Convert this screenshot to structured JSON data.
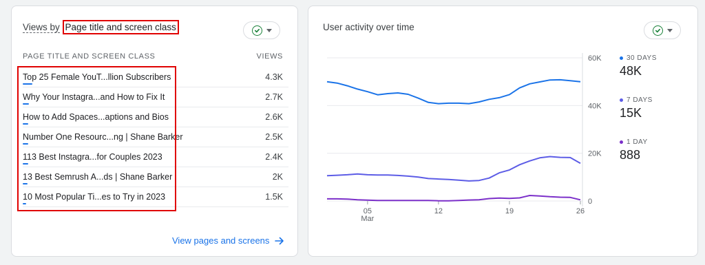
{
  "left_card": {
    "title_prefix": "Views by",
    "title_dimension": "Page title and screen class",
    "col_page": "PAGE TITLE AND SCREEN CLASS",
    "col_views": "VIEWS",
    "rows": [
      {
        "title": "Top 25 Female YouT...llion Subscribers",
        "views": "4.3K",
        "views_num": 4300
      },
      {
        "title": "Why Your Instagra...and How to Fix It",
        "views": "2.7K",
        "views_num": 2700
      },
      {
        "title": "How to Add Spaces...aptions and Bios",
        "views": "2.6K",
        "views_num": 2600
      },
      {
        "title": "Number One Resourc...ng | Shane Barker",
        "views": "2.5K",
        "views_num": 2500
      },
      {
        "title": "113 Best Instagra...for Couples 2023",
        "views": "2.4K",
        "views_num": 2400
      },
      {
        "title": "13 Best Semrush A...ds | Shane Barker",
        "views": "2K",
        "views_num": 2000
      },
      {
        "title": "10 Most Popular Ti...es to Try in 2023",
        "views": "1.5K",
        "views_num": 1500
      }
    ],
    "link": "View pages and screens"
  },
  "right_card": {
    "title": "User activity over time",
    "legend": [
      {
        "label": "30 DAYS",
        "value": "48K",
        "color": "#1a73e8"
      },
      {
        "label": "7 DAYS",
        "value": "15K",
        "color": "#5c5ce6"
      },
      {
        "label": "1 DAY",
        "value": "888",
        "color": "#7b2fc9"
      }
    ]
  },
  "icons": {
    "check": "check-circle-icon",
    "caret": "caret-down-icon",
    "arrow": "arrow-right-icon"
  },
  "chart_data": {
    "type": "line",
    "x": [
      1,
      2,
      3,
      4,
      5,
      6,
      7,
      8,
      9,
      10,
      11,
      12,
      13,
      14,
      15,
      16,
      17,
      18,
      19,
      20,
      21,
      22,
      23,
      24,
      25,
      26
    ],
    "x_ticks": [
      "05",
      "12",
      "19",
      "26"
    ],
    "x_tick_values": [
      5,
      12,
      19,
      26
    ],
    "x_month_label": "Mar",
    "y_ticks": [
      "60K",
      "40K",
      "20K",
      "0"
    ],
    "y_tick_values": [
      60000,
      40000,
      20000,
      0
    ],
    "ylim": [
      0,
      60000
    ],
    "series": [
      {
        "name": "30 DAYS",
        "color": "#1a73e8",
        "values": [
          50000,
          49400,
          48300,
          46900,
          45800,
          44500,
          45000,
          45300,
          44700,
          43100,
          41300,
          40800,
          41000,
          41000,
          40800,
          41500,
          42600,
          43300,
          44600,
          47400,
          49100,
          49900,
          50700,
          50800,
          50400,
          50000
        ]
      },
      {
        "name": "7 DAYS",
        "color": "#5c5ce6",
        "values": [
          10600,
          10800,
          11000,
          11300,
          11000,
          10900,
          10900,
          10700,
          10400,
          10000,
          9400,
          9200,
          9000,
          8700,
          8400,
          8600,
          9600,
          11800,
          13000,
          15200,
          16800,
          18100,
          18600,
          18300,
          18200,
          15800
        ]
      },
      {
        "name": "1 DAY",
        "color": "#7b2fc9",
        "values": [
          900,
          900,
          800,
          500,
          350,
          200,
          200,
          200,
          200,
          200,
          200,
          100,
          100,
          200,
          400,
          500,
          1000,
          1200,
          1100,
          1300,
          2300,
          2100,
          1800,
          1600,
          1500,
          500
        ]
      }
    ]
  }
}
